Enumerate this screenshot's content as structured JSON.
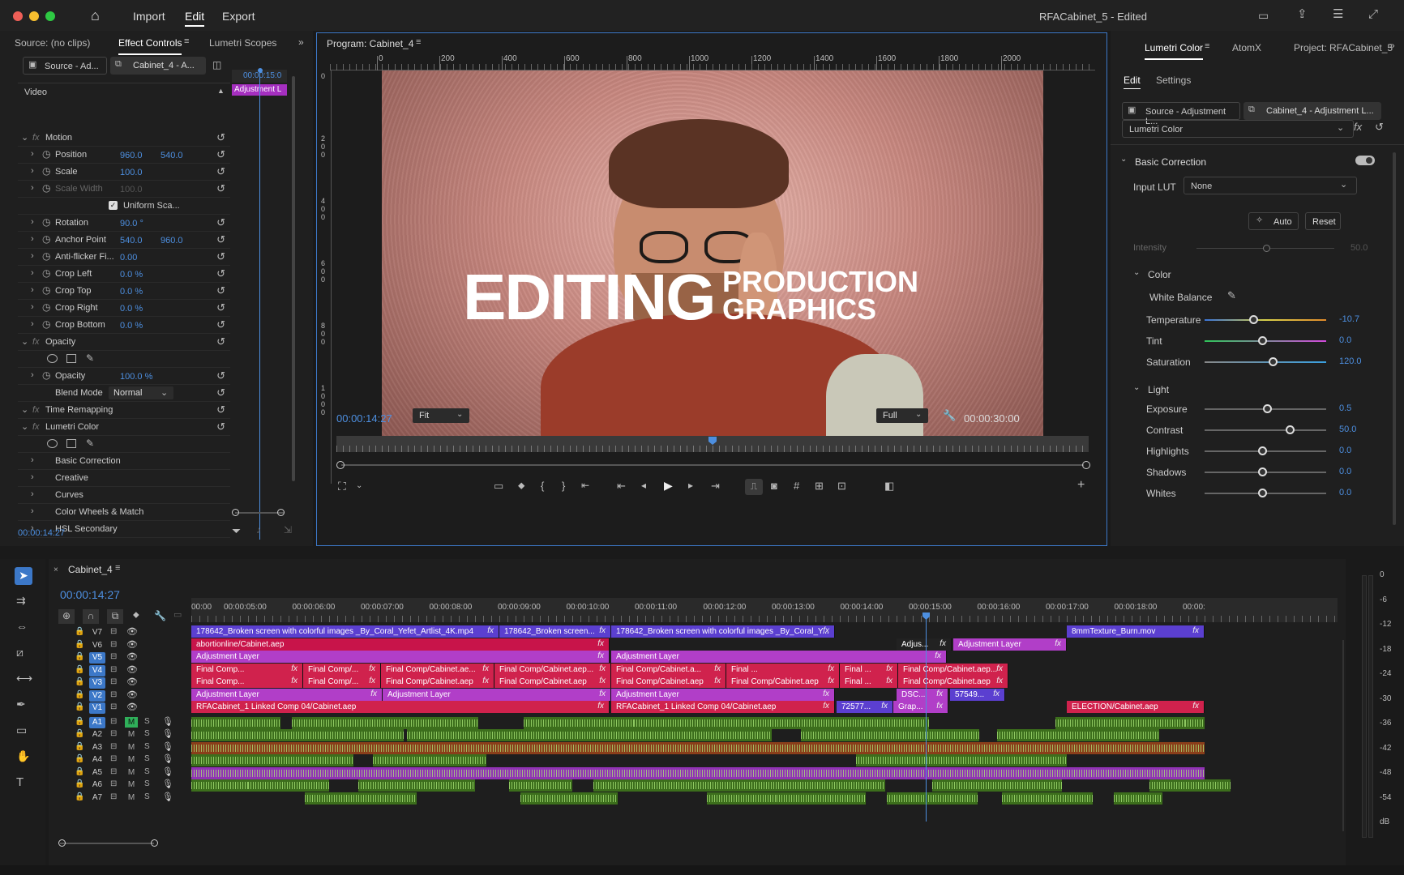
{
  "topbar": {
    "nav": [
      "Import",
      "Edit",
      "Export"
    ],
    "project_title": "RFACabinet_5 - Edited"
  },
  "source_panel": {
    "tabs": [
      "Source: (no clips)",
      "Effect Controls",
      "Lumetri Scopes"
    ],
    "source_selector": "Source - Ad...",
    "sequence_selector": "Cabinet_4 - A...",
    "mini_timecode": "00:00:15:0",
    "mini_clip": "Adjustment L",
    "section": "Video",
    "timecode": "00:00:14:27",
    "rows": [
      {
        "label": "Motion",
        "fx": true
      },
      {
        "label": "Position",
        "v1": "960.0",
        "v2": "540.0"
      },
      {
        "label": "Scale",
        "v1": "100.0"
      },
      {
        "label": "Scale Width",
        "v1": "100.0",
        "dim": true
      },
      {
        "label": "Uniform Sca...",
        "checkbox": true
      },
      {
        "label": "Rotation",
        "v1": "90.0 °"
      },
      {
        "label": "Anchor Point",
        "v1": "540.0",
        "v2": "960.0"
      },
      {
        "label": "Anti-flicker Fi...",
        "v1": "0.00"
      },
      {
        "label": "Crop Left",
        "v1": "0.0 %"
      },
      {
        "label": "Crop Top",
        "v1": "0.0 %"
      },
      {
        "label": "Crop Right",
        "v1": "0.0 %"
      },
      {
        "label": "Crop Bottom",
        "v1": "0.0 %"
      },
      {
        "label": "Opacity",
        "fx": true
      },
      {
        "label": "",
        "masks": true
      },
      {
        "label": "Opacity",
        "v1": "100.0 %"
      },
      {
        "label": "Blend Mode",
        "select": "Normal"
      },
      {
        "label": "Time Remapping",
        "fx": true
      },
      {
        "label": "Lumetri Color",
        "fx": true
      },
      {
        "label": "",
        "masks": true
      },
      {
        "label": "Basic Correction"
      },
      {
        "label": "Creative"
      },
      {
        "label": "Curves"
      },
      {
        "label": "Color Wheels & Match"
      },
      {
        "label": "HSL Secondary"
      }
    ]
  },
  "program": {
    "title": "Program: Cabinet_4",
    "ruler": [
      "0",
      "200",
      "400",
      "600",
      "800",
      "1000",
      "1200",
      "1400",
      "1600",
      "1800",
      "2000"
    ],
    "vruler": [
      "0",
      "2\n0\n0",
      "4\n0\n0",
      "6\n0\n0",
      "8\n0\n0",
      "1\n0\n0\n0"
    ],
    "headline": "EDITING",
    "sub1": "PRODUCTION",
    "sub2": "GRAPHICS",
    "timecode": "00:00:14:27",
    "zoom": "Fit",
    "quality": "Full",
    "duration": "00:00:30:00",
    "playhead": 0.5
  },
  "lumetri": {
    "tabs": [
      "Lumetri Color",
      "AtomX",
      "Project: RFACabinet_5"
    ],
    "subtabs": [
      "Edit",
      "Settings"
    ],
    "source": "Source - Adjustment L...",
    "sequence": "Cabinet_4 - Adjustment L...",
    "effect": "Lumetri Color",
    "section": "Basic Correction",
    "input_lut_label": "Input LUT",
    "input_lut": "None",
    "auto": "Auto",
    "reset": "Reset",
    "intensity_label": "Intensity",
    "intensity": "50.0",
    "color_label": "Color",
    "wb_label": "White Balance",
    "light_label": "Light",
    "sliders": [
      {
        "label": "Temperature",
        "value": "-10.7",
        "pos": 0.4
      },
      {
        "label": "Tint",
        "value": "0.0",
        "pos": 0.47
      },
      {
        "label": "Saturation",
        "value": "120.0",
        "pos": 0.56
      },
      {
        "label": "Exposure",
        "value": "0.5",
        "pos": 0.51
      },
      {
        "label": "Contrast",
        "value": "50.0",
        "pos": 0.7
      },
      {
        "label": "Highlights",
        "value": "0.0",
        "pos": 0.47
      },
      {
        "label": "Shadows",
        "value": "0.0",
        "pos": 0.47
      },
      {
        "label": "Whites",
        "value": "0.0",
        "pos": 0.47
      }
    ]
  },
  "timeline": {
    "name": "Cabinet_4",
    "timecode": "00:00:14:27",
    "ruler": [
      "00:00",
      "00:00:05:00",
      "00:00:06:00",
      "00:00:07:00",
      "00:00:08:00",
      "00:00:09:00",
      "00:00:10:00",
      "00:00:11:00",
      "00:00:12:00",
      "00:00:13:00",
      "00:00:14:00",
      "00:00:15:00",
      "00:00:16:00",
      "00:00:17:00",
      "00:00:18:00",
      "00:00:"
    ],
    "video_tracks": [
      "V7",
      "V6",
      "V5",
      "V4",
      "V3",
      "V2",
      "V1"
    ],
    "audio_tracks": [
      "A1",
      "A2",
      "A3",
      "A4",
      "A5",
      "A6",
      "A7"
    ],
    "clips": {
      "v7a": "178642_Broken screen with colorful images _By_Coral_Yefet_Artlist_4K.mp4",
      "v7b": "178642_Broken screen...",
      "v7c": "178642_Broken screen with colorful images _By_Coral_Y...",
      "v7d": "8mmTexture_Burn.mov",
      "v6a": "abortionline/Cabinet.aep",
      "v6b": "Adjus...",
      "v6c": "Adjustment Layer",
      "v5a": "Adjustment Layer",
      "v5b": "Adjustment Layer",
      "v4a": "Final Comp...",
      "v4b": "Final Comp/...",
      "v4c": "Final Comp/Cabinet.ae...",
      "v4d": "Final Comp/Cabinet.aep...",
      "v4e": "Final Comp/Cabinet.a...",
      "v4f": "Final ...",
      "v4g": "Final Comp/Cabinet.aep...",
      "v3a": "Final Comp...",
      "v3b": "Final Comp/...",
      "v3c": "Final Comp/Cabinet.aep",
      "v3d": "Final Comp/Cabinet.aep",
      "v3e": "Final Comp/Cabinet.aep",
      "v3f": "Final Comp/Cabinet.aep",
      "v3g": "Final ...",
      "v3h": "Final Comp/Cabinet.aep",
      "v2a": "Adjustment Layer",
      "v2b": "Adjustment Layer",
      "v2c": "Adjustment Layer",
      "v2d": "DSC...",
      "v2e": "57549...",
      "v1a": "RFACabinet_1 Linked Comp 04/Cabinet.aep",
      "v1b": "RFACabinet_1 Linked Comp 04/Cabinet.aep",
      "v1c": "72577...",
      "v1d": "Grap...",
      "v1e": "ELECTION/Cabinet.aep"
    },
    "fx": "fx",
    "solo": "S",
    "mute": "M"
  },
  "meter": {
    "labels": [
      "0",
      "-6",
      "-12",
      "-18",
      "-24",
      "-30",
      "-36",
      "-42",
      "-48",
      "-54",
      "dB"
    ]
  },
  "colors": {
    "accent": "#4d8fe0",
    "clip_blue": "#5b3fd0",
    "clip_magenta": "#b13ec8",
    "clip_pink": "#c8144a",
    "clip_red": "#d0224d",
    "audio_green": "#3c6e1c",
    "audio_orange": "#8a3e1a",
    "audio_purple": "#9133b5"
  }
}
